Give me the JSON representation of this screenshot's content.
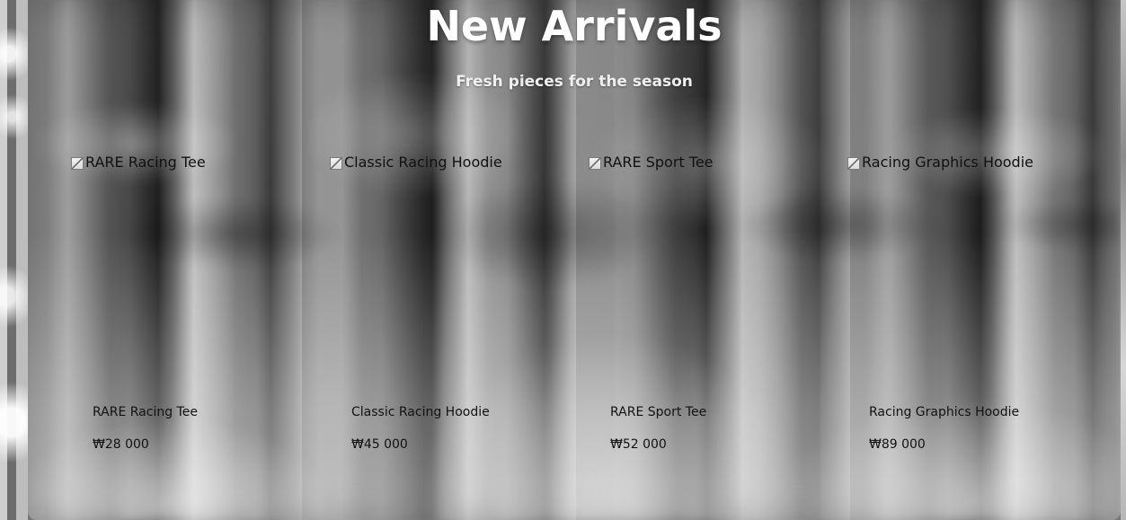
{
  "header": {
    "title": "New Arrivals",
    "subtitle": "Fresh pieces for the season"
  },
  "products": [
    {
      "image_alt": "RARE Racing Tee",
      "name": "RARE Racing Tee",
      "price": "₩28 000"
    },
    {
      "image_alt": "Classic Racing Hoodie",
      "name": "Classic Racing Hoodie",
      "price": "₩45 000"
    },
    {
      "image_alt": "RARE Sport Tee",
      "name": "RARE Sport Tee",
      "price": "₩52 000"
    },
    {
      "image_alt": "Racing Graphics Hoodie",
      "name": "Racing Graphics Hoodie",
      "price": "₩89 000"
    }
  ],
  "colors": {
    "title": "#ffffff",
    "subtitle": "#efefef",
    "product_text": "#121212"
  },
  "icons": {
    "broken_image": "broken-image-icon"
  }
}
